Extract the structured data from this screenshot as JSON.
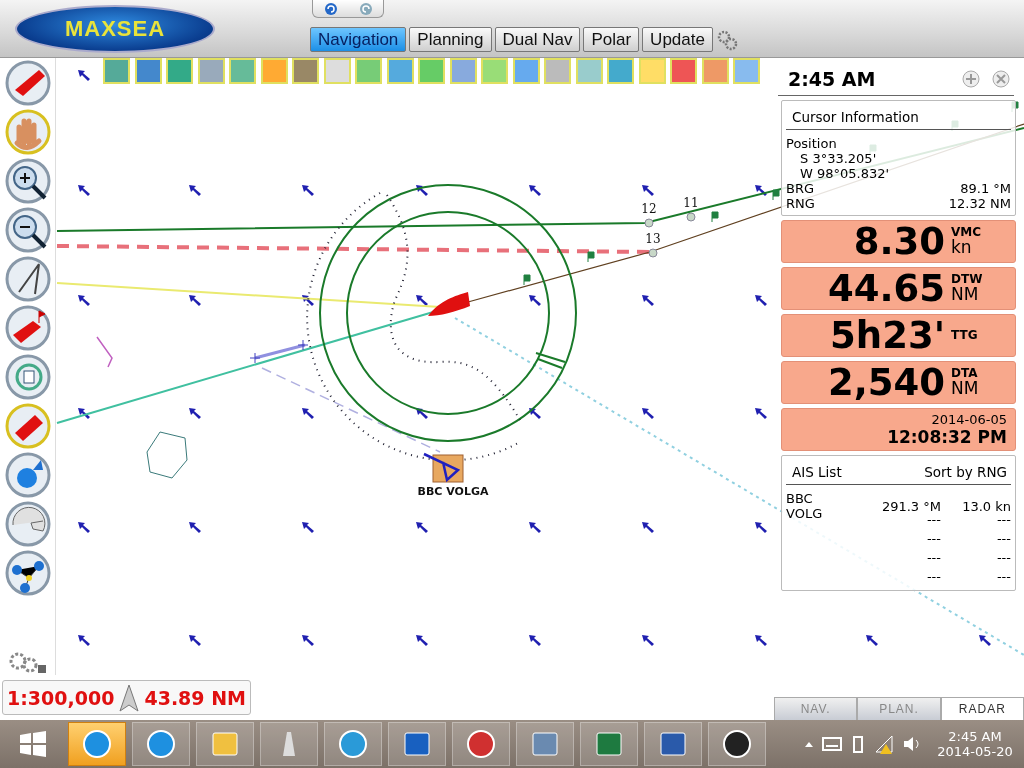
{
  "app": {
    "logo": "MAXSEA"
  },
  "tabs": [
    {
      "label": "Navigation",
      "selected": true
    },
    {
      "label": "Planning",
      "selected": false
    },
    {
      "label": "Dual Nav",
      "selected": false
    },
    {
      "label": "Polar",
      "selected": false
    },
    {
      "label": "Update",
      "selected": false
    }
  ],
  "clock": "2:45 AM",
  "cursor_information": {
    "title": "Cursor Information",
    "position_label": "Position",
    "latitude": "S 3°33.205'",
    "longitude": "W 98°05.832'",
    "rows": [
      {
        "label": "BRG",
        "value": "89.1 °M"
      },
      {
        "label": "RNG",
        "value": "12.32 NM"
      }
    ]
  },
  "data_boxes": [
    {
      "value": "8.30",
      "label": "VMC",
      "unit": "kn"
    },
    {
      "value": "44.65",
      "label": "DTW",
      "unit": "NM"
    },
    {
      "value": "5h23'",
      "label": "TTG"
    },
    {
      "value": "2,540",
      "label": "DTA",
      "unit": "NM"
    }
  ],
  "date_box": {
    "date": "2014-06-05",
    "time": "12:08:32 PM"
  },
  "ais_list": {
    "title": "AIS List",
    "sort": "Sort by RNG",
    "rows": [
      {
        "name": "BBC VOLG",
        "bearing": "291.3 °M",
        "speed": "13.0 kn"
      },
      {
        "bearing": "---",
        "speed": "---"
      },
      {
        "bearing": "---",
        "speed": "---"
      },
      {
        "bearing": "---",
        "speed": "---"
      },
      {
        "bearing": "---",
        "speed": "---"
      }
    ]
  },
  "map": {
    "waypoints": [
      {
        "label": "12"
      },
      {
        "label": "11"
      },
      {
        "label": "13"
      }
    ],
    "vessel_label": "BBC VOLGA"
  },
  "scale": {
    "ratio": "1:300,000",
    "distance": "43.89 NM"
  },
  "panel_tabs": [
    {
      "label": "NAV.",
      "selected": false
    },
    {
      "label": "PLAN.",
      "selected": false
    },
    {
      "label": "RADAR",
      "selected": true
    }
  ],
  "taskbar": {
    "time": "2:45 AM",
    "date": "2014-05-20"
  }
}
